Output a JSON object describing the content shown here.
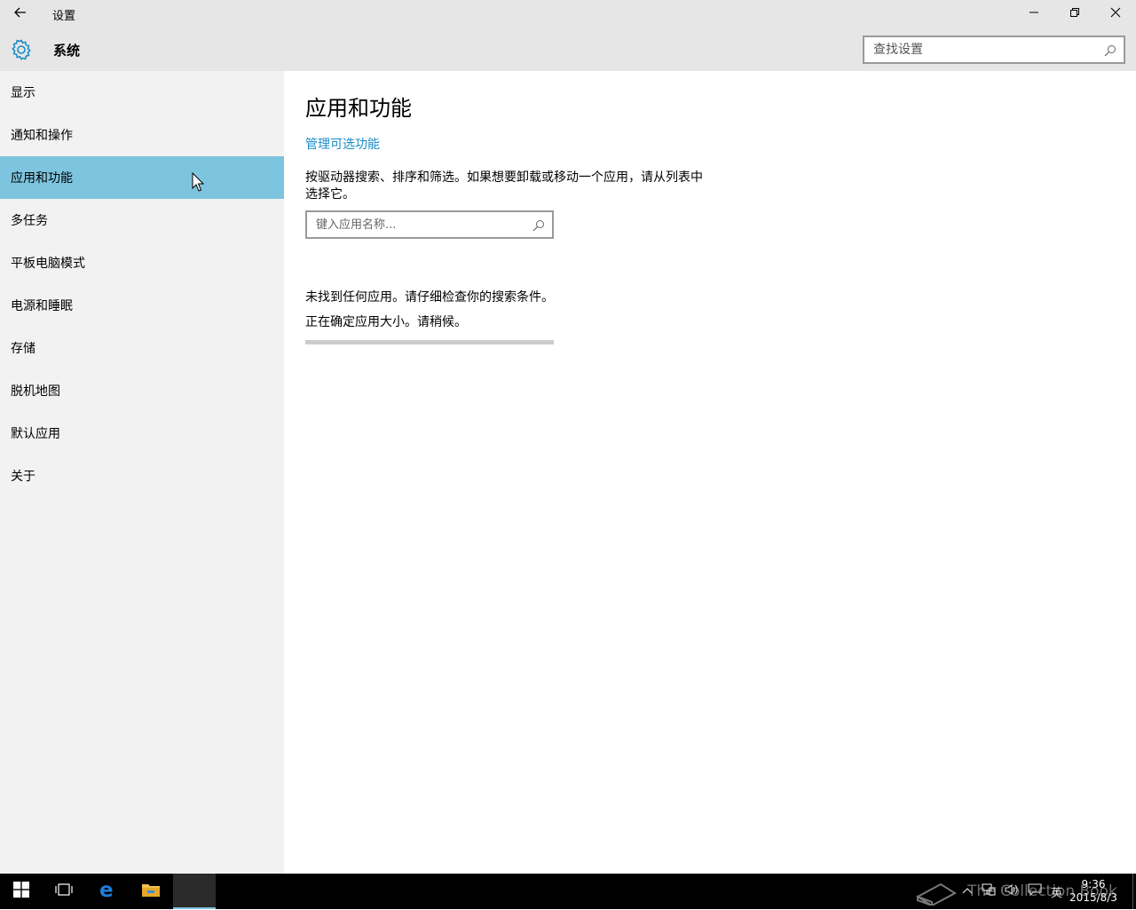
{
  "titlebar": {
    "back_icon": "arrow-left",
    "title": "设置",
    "minimize_icon": "minimize",
    "restore_icon": "restore",
    "close_icon": "close"
  },
  "header": {
    "section_icon": "gear",
    "section_title": "系统",
    "search_placeholder": "查找设置"
  },
  "sidebar": {
    "items": [
      {
        "label": "显示"
      },
      {
        "label": "通知和操作"
      },
      {
        "label": "应用和功能",
        "active": true
      },
      {
        "label": "多任务"
      },
      {
        "label": "平板电脑模式"
      },
      {
        "label": "电源和睡眠"
      },
      {
        "label": "存储"
      },
      {
        "label": "脱机地图"
      },
      {
        "label": "默认应用"
      },
      {
        "label": "关于"
      }
    ]
  },
  "main": {
    "title": "应用和功能",
    "manage_link": "管理可选功能",
    "description": "按驱动器搜索、排序和筛选。如果想要卸载或移动一个应用，请从列表中选择它。",
    "filter_placeholder": "键入应用名称...",
    "no_apps_message": "未找到任何应用。请仔细检查你的搜索条件。",
    "sizing_message": "正在确定应用大小。请稍候。",
    "progress": 0
  },
  "taskbar": {
    "items": [
      "windows-start",
      "task-view",
      "edge",
      "file-explorer",
      "settings-app"
    ],
    "tray": {
      "icons": [
        "chevron-up",
        "network",
        "volume",
        "action-center"
      ],
      "language": "英",
      "time": "9:36",
      "date": "2015/8/3"
    },
    "watermark": "The Collection Book"
  },
  "colors": {
    "accent": "#7dc4de",
    "link": "#1a8cc8",
    "titlebar_bg": "#e6e6e6",
    "sidebar_bg": "#f2f2f2",
    "taskbar_bg": "#000000"
  }
}
